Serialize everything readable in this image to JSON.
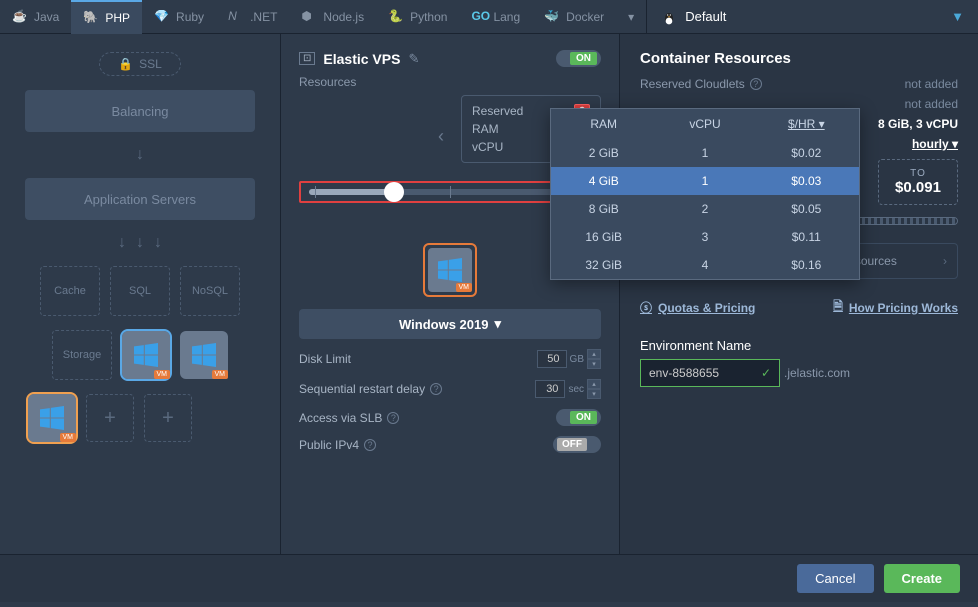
{
  "tabs": [
    "Java",
    "PHP",
    "Ruby",
    ".NET",
    "Node.js",
    "Python",
    "Lang",
    "Docker"
  ],
  "env_selector": {
    "label": "Default"
  },
  "left": {
    "ssl": "SSL",
    "balancing": "Balancing",
    "app_servers": "Application Servers",
    "cache": "Cache",
    "sql": "SQL",
    "nosql": "NoSQL",
    "storage": "Storage",
    "vm": "VM"
  },
  "mid": {
    "title": "Elastic VPS",
    "on": "ON",
    "off": "OFF",
    "resources_label": "Resources",
    "reserved": "Reserved",
    "ram_label": "RAM",
    "ram_val": "4 GiB",
    "vcpu_label": "vCPU",
    "vcpu_val": "1",
    "os": "Windows 2019",
    "disk_limit": "Disk Limit",
    "disk_val": "50",
    "disk_unit": "GB",
    "restart": "Sequential restart delay",
    "restart_val": "30",
    "restart_unit": "sec",
    "slb": "Access via SLB",
    "ipv4": "Public IPv4"
  },
  "right": {
    "title": "Container Resources",
    "reserved_cloudlets": "Reserved Cloudlets",
    "not_added": "not added",
    "scaling_limit_val": "8 GiB, 3 vCPU",
    "hourly": "hourly",
    "to_label": "TO",
    "to_val": "$0.091",
    "info": "You do not pay for unused resources",
    "quotas": "Quotas & Pricing",
    "pricing_works": "How Pricing Works",
    "env_name_label": "Environment Name",
    "env_name_val": "env-8588655",
    "domain": ".jelastic.com"
  },
  "popup": {
    "headers": [
      "RAM",
      "vCPU",
      "$/HR"
    ],
    "rows": [
      {
        "ram": "2 GiB",
        "vcpu": "1",
        "price": "$0.02"
      },
      {
        "ram": "4 GiB",
        "vcpu": "1",
        "price": "$0.03",
        "selected": true
      },
      {
        "ram": "8 GiB",
        "vcpu": "2",
        "price": "$0.05"
      },
      {
        "ram": "16 GiB",
        "vcpu": "3",
        "price": "$0.11"
      },
      {
        "ram": "32 GiB",
        "vcpu": "4",
        "price": "$0.16"
      }
    ]
  },
  "footer": {
    "cancel": "Cancel",
    "create": "Create"
  }
}
